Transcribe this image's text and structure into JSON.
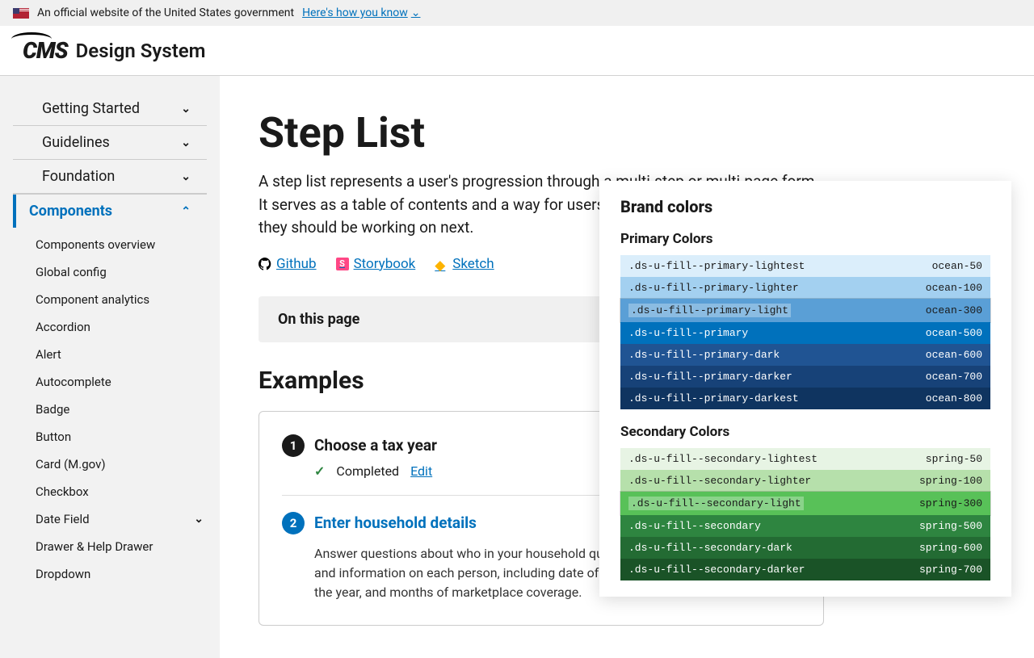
{
  "banner": {
    "text": "An official website of the United States government",
    "link": "Here's how you know"
  },
  "brand": {
    "mark": "CMS",
    "title": "Design System"
  },
  "nav": {
    "top": [
      {
        "label": "Getting Started"
      },
      {
        "label": "Guidelines"
      },
      {
        "label": "Foundation"
      },
      {
        "label": "Components"
      }
    ],
    "sub": [
      "Components overview",
      "Global config",
      "Component analytics",
      "Accordion",
      "Alert",
      "Autocomplete",
      "Badge",
      "Button",
      "Card (M.gov)",
      "Checkbox",
      "Date Field",
      "Drawer & Help Drawer",
      "Dropdown"
    ]
  },
  "page": {
    "title": "Step List",
    "desc": "A step list represents a user's progression through a multi-step or multi-page form. It serves as a table of contents and a way for users to see where they are and what they should be working on next.",
    "links": {
      "github": "Github",
      "storybook": "Storybook",
      "sketch": "Sketch"
    },
    "toc": "On this page",
    "section": "Examples",
    "steps": [
      {
        "num": "1",
        "title": "Choose a tax year",
        "status": "Completed",
        "action": "Edit"
      },
      {
        "num": "2",
        "title": "Enter household details",
        "desc": "Answer questions about who in your household qualifies for a premium tax credit and information on each person, including date of birth, location(s) they lived in for the year, and months of marketplace coverage."
      }
    ]
  },
  "overlay": {
    "heading": "Brand colors",
    "primary_h": "Primary Colors",
    "secondary_h": "Secondary Colors",
    "primary": [
      {
        "class": ".ds-u-fill--primary-lightest",
        "token": "ocean-50",
        "bg": "#dbeefb",
        "fg": "#1a1a1a"
      },
      {
        "class": ".ds-u-fill--primary-lighter",
        "token": "ocean-100",
        "bg": "#a3d0f0",
        "fg": "#1a1a1a"
      },
      {
        "class": ".ds-u-fill--primary-light",
        "token": "ocean-300",
        "bg": "#5a9fd6",
        "fg": "#1a1a1a",
        "hl": true
      },
      {
        "class": ".ds-u-fill--primary",
        "token": "ocean-500",
        "bg": "#0071bc",
        "fg": "#fff"
      },
      {
        "class": ".ds-u-fill--primary-dark",
        "token": "ocean-600",
        "bg": "#205493",
        "fg": "#fff"
      },
      {
        "class": ".ds-u-fill--primary-darker",
        "token": "ocean-700",
        "bg": "#174278",
        "fg": "#fff"
      },
      {
        "class": ".ds-u-fill--primary-darkest",
        "token": "ocean-800",
        "bg": "#0f3460",
        "fg": "#fff"
      }
    ],
    "secondary": [
      {
        "class": ".ds-u-fill--secondary-lightest",
        "token": "spring-50",
        "bg": "#e7f4e4",
        "fg": "#1a1a1a"
      },
      {
        "class": ".ds-u-fill--secondary-lighter",
        "token": "spring-100",
        "bg": "#b6e0ab",
        "fg": "#1a1a1a"
      },
      {
        "class": ".ds-u-fill--secondary-light",
        "token": "spring-300",
        "bg": "#58c158",
        "fg": "#1a1a1a",
        "hl": true
      },
      {
        "class": ".ds-u-fill--secondary",
        "token": "spring-500",
        "bg": "#2e8540",
        "fg": "#fff"
      },
      {
        "class": ".ds-u-fill--secondary-dark",
        "token": "spring-600",
        "bg": "#236b33",
        "fg": "#fff"
      },
      {
        "class": ".ds-u-fill--secondary-darker",
        "token": "spring-700",
        "bg": "#1a5327",
        "fg": "#fff"
      }
    ]
  }
}
